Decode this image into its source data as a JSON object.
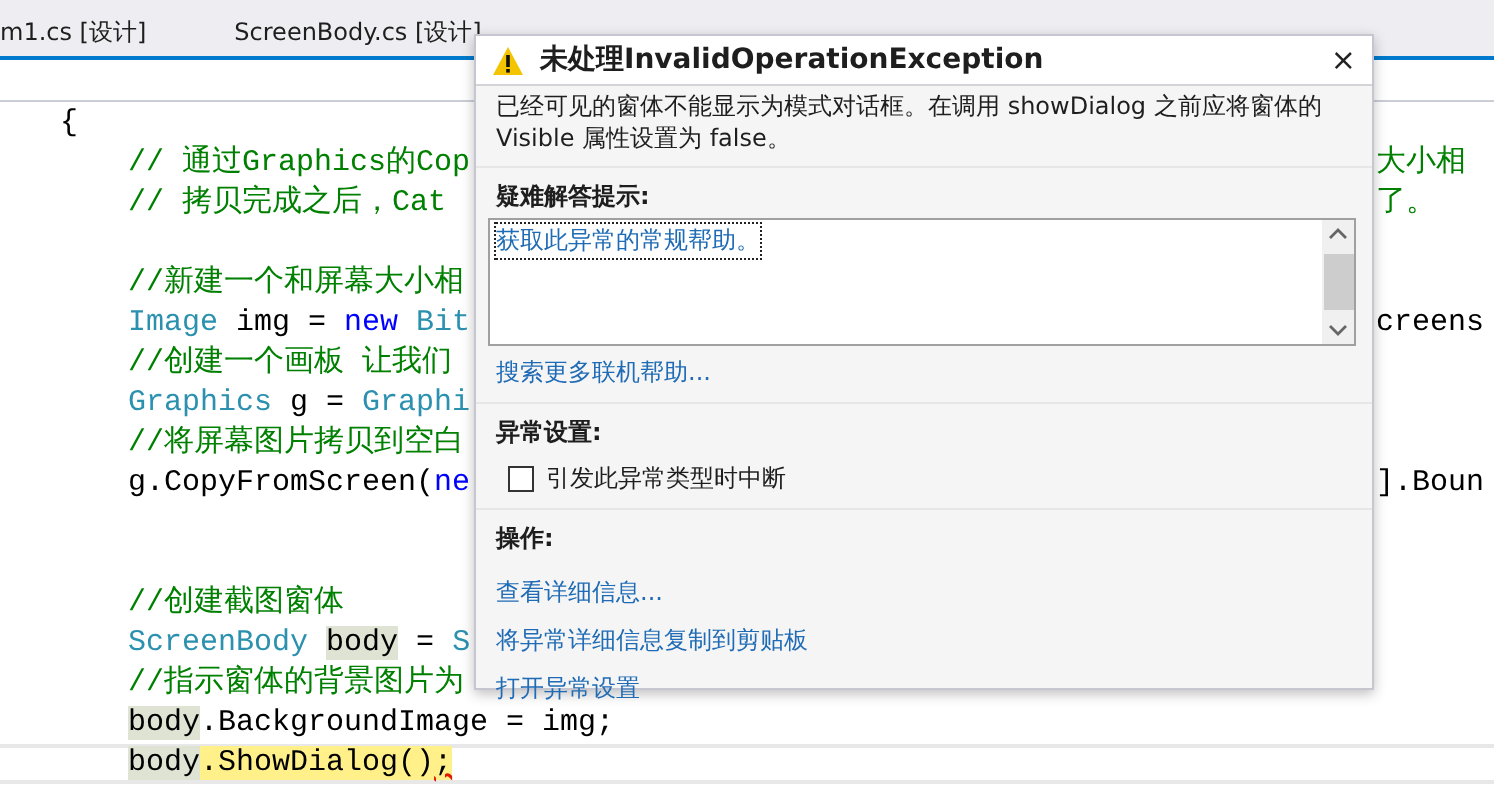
{
  "tabs": [
    {
      "label": "m1.cs [设计]",
      "selected": false
    },
    {
      "label": "ScreenBody.cs [设计]",
      "selected": false
    }
  ],
  "code": {
    "brace": "{",
    "lines": [
      {
        "current": false,
        "left": [
          {
            "text": "// 通过Graphics的Cop",
            "kind": "comment"
          }
        ],
        "right": [
          {
            "text": "大小相",
            "kind": "comment"
          }
        ]
      },
      {
        "current": false,
        "left": [
          {
            "text": "// 拷贝完成之后，Cat",
            "kind": "comment"
          }
        ],
        "right": [
          {
            "text": "了。",
            "kind": "comment"
          }
        ]
      },
      {
        "current": false
      },
      {
        "current": false,
        "left": [
          {
            "text": "//新建一个和屏幕大小相",
            "kind": "comment"
          }
        ]
      },
      {
        "current": false,
        "left": [
          {
            "text": "Image",
            "kind": "type"
          },
          {
            "text": " img = ",
            "kind": "plain"
          },
          {
            "text": "new",
            "kind": "keyword"
          },
          {
            "text": " Bit",
            "kind": "type"
          }
        ],
        "right": [
          {
            "text": "creens",
            "kind": "plain"
          }
        ]
      },
      {
        "current": false,
        "left": [
          {
            "text": "//创建一个画板 让我们",
            "kind": "comment"
          }
        ]
      },
      {
        "current": false,
        "left": [
          {
            "text": "Graphics",
            "kind": "type"
          },
          {
            "text": " g = ",
            "kind": "plain"
          },
          {
            "text": "Graphi",
            "kind": "type"
          }
        ]
      },
      {
        "current": false,
        "left": [
          {
            "text": "//将屏幕图片拷贝到空白",
            "kind": "comment"
          }
        ]
      },
      {
        "current": false,
        "left": [
          {
            "text": "g.CopyFromScreen(",
            "kind": "plain"
          },
          {
            "text": "ne",
            "kind": "keyword"
          }
        ],
        "right": [
          {
            "text": "].Boun",
            "kind": "plain"
          }
        ]
      },
      {
        "current": false
      },
      {
        "current": false
      },
      {
        "current": false,
        "left": [
          {
            "text": "//创建截图窗体",
            "kind": "comment"
          }
        ]
      },
      {
        "current": false,
        "left": [
          {
            "text": "ScreenBody ",
            "kind": "type"
          },
          {
            "text": "body",
            "kind": "reference"
          },
          {
            "text": " = ",
            "kind": "plain"
          },
          {
            "text": "S",
            "kind": "type"
          }
        ]
      },
      {
        "current": false,
        "left": [
          {
            "text": "//指示窗体的背景图片为",
            "kind": "comment"
          }
        ]
      },
      {
        "current": false,
        "left": [
          {
            "text": "body",
            "kind": "reference"
          },
          {
            "text": ".BackgroundImage = img;",
            "kind": "plain"
          }
        ]
      },
      {
        "current": true,
        "left": [
          {
            "text": "body",
            "kind": "reference"
          },
          {
            "text": ".ShowDialog()",
            "kind": "statement"
          },
          {
            "text": ";",
            "kind": "error"
          }
        ]
      }
    ]
  },
  "dialog": {
    "title": "未处理InvalidOperationException",
    "close": "×",
    "message": "已经可见的窗体不能显示为模式对话框。在调用 showDialog 之前应将窗体的 Visible 属性设置为 false。",
    "troubleshooting": {
      "heading": "疑难解答提示:",
      "tips": [
        {
          "text": "获取此异常的常规帮助。",
          "selected": true
        }
      ],
      "more_link": "搜索更多联机帮助..."
    },
    "settings": {
      "heading": "异常设置:",
      "checkbox": {
        "label": "引发此异常类型时中断",
        "checked": false
      }
    },
    "actions": {
      "heading": "操作:",
      "links": [
        "查看详细信息...",
        "将异常详细信息复制到剪贴板",
        "打开异常设置"
      ]
    }
  }
}
